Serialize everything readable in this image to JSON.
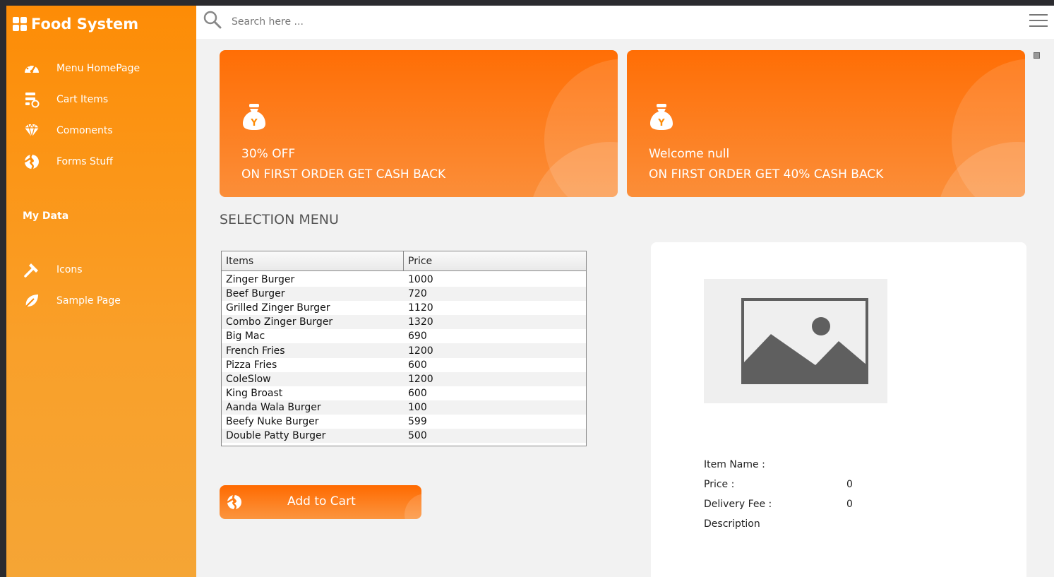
{
  "app": {
    "title": "Food System"
  },
  "sidebar": {
    "items": [
      {
        "label": "Menu HomePage",
        "icon": "dashboard-icon"
      },
      {
        "label": "Cart Items",
        "icon": "cart-list-icon"
      },
      {
        "label": "Comonents",
        "icon": "diamond-icon"
      },
      {
        "label": "Forms Stuff",
        "icon": "swirl-icon"
      }
    ],
    "section": "My Data",
    "items2": [
      {
        "label": "Icons",
        "icon": "tools-icon"
      },
      {
        "label": "Sample Page",
        "icon": "leaf-icon"
      }
    ]
  },
  "header": {
    "search_placeholder": "Search here ..."
  },
  "promos": [
    {
      "line1": "30% OFF",
      "line2": "ON FIRST ORDER GET CASH BACK"
    },
    {
      "line1": "Welcome null",
      "line2": "ON FIRST ORDER GET 40% CASH BACK"
    }
  ],
  "selection_title": "SELECTION MENU",
  "table": {
    "columns": [
      "Items",
      "Price"
    ],
    "rows": [
      [
        "Zinger Burger",
        "1000"
      ],
      [
        "Beef Burger",
        "720"
      ],
      [
        "Grilled Zinger Burger",
        "1120"
      ],
      [
        "Combo Zinger Burger",
        "1320"
      ],
      [
        "Big Mac",
        "690"
      ],
      [
        "French Fries",
        "1200"
      ],
      [
        "Pizza Fries",
        "600"
      ],
      [
        "ColeSlow",
        "1200"
      ],
      [
        "King Broast",
        "600"
      ],
      [
        "Aanda Wala Burger",
        "100"
      ],
      [
        "Beefy Nuke Burger",
        "599"
      ],
      [
        "Double Patty Burger",
        "500"
      ]
    ]
  },
  "add_to_cart": "Add to Cart",
  "detail": {
    "item_name_label": "Item Name :",
    "price_label": "Price :",
    "price_value": "0",
    "delivery_label": "Delivery Fee :",
    "delivery_value": "0",
    "description_label": "Description"
  },
  "colors": {
    "accent": "#ff6e05",
    "sidebar": "#fd8c06"
  }
}
